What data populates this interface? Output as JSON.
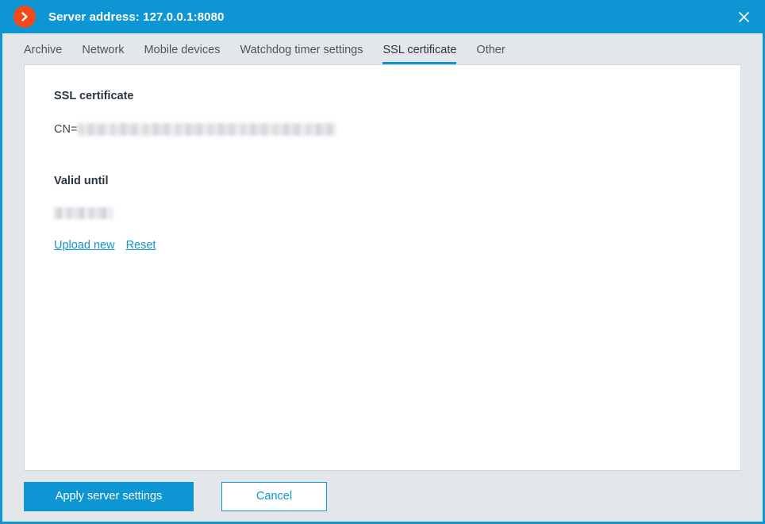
{
  "window": {
    "title": "Server address: 127.0.0.1:8080",
    "logo_icon": "orange-chevron-right-logo",
    "close_icon": "close-icon",
    "accent_color": "#0d95d4",
    "logo_color": "#f24a1b",
    "chrome_background": "#e4e7ea"
  },
  "tabs": [
    {
      "label": "Archive",
      "active": false
    },
    {
      "label": "Network",
      "active": false
    },
    {
      "label": "Mobile devices",
      "active": false
    },
    {
      "label": "Watchdog timer settings",
      "active": false
    },
    {
      "label": "SSL certificate",
      "active": true
    },
    {
      "label": "Other",
      "active": false
    }
  ],
  "content": {
    "certificate": {
      "heading": "SSL certificate",
      "cn_label": "CN=",
      "cn_value": ""
    },
    "valid_until": {
      "heading": "Valid until",
      "value": ""
    },
    "actions": {
      "upload_label": "Upload new",
      "reset_label": "Reset"
    }
  },
  "footer": {
    "apply_label": "Apply server settings",
    "cancel_label": "Cancel"
  }
}
